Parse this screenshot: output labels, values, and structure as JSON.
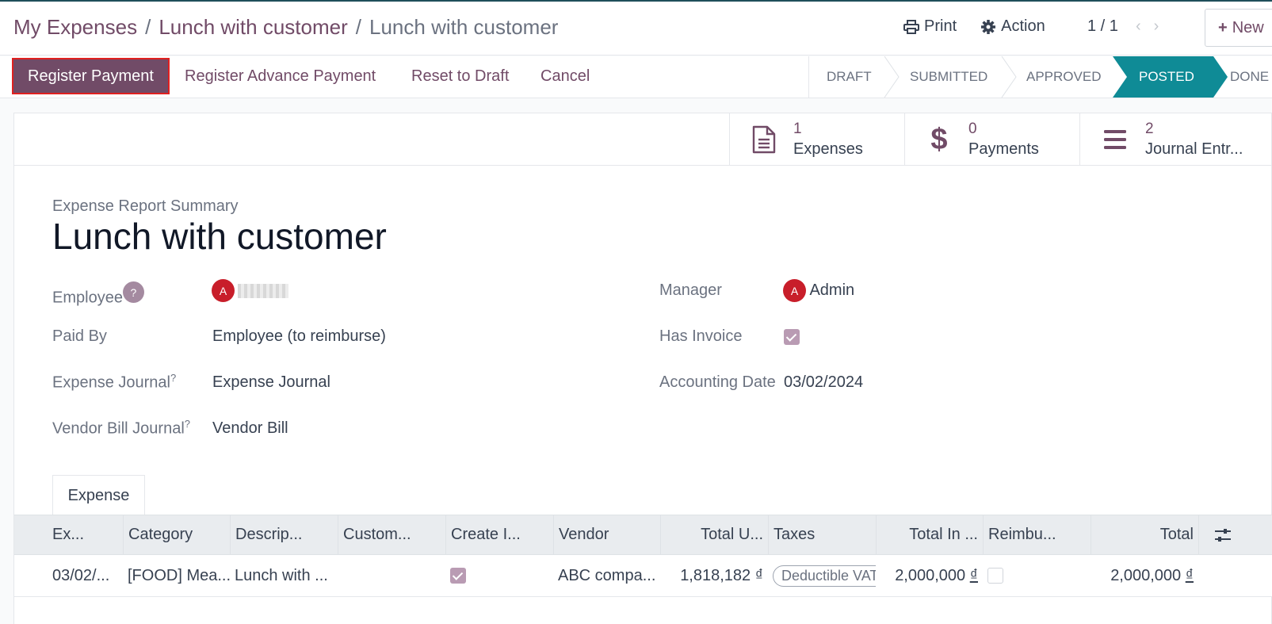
{
  "breadcrumb": {
    "root": "My Expenses",
    "parent": "Lunch with customer",
    "current": "Lunch with customer",
    "sep": "/"
  },
  "controls": {
    "print": "Print",
    "action": "Action",
    "pager": "1 / 1",
    "new": "New"
  },
  "statusbar": {
    "buttons": [
      "Register Payment",
      "Register Advance Payment",
      "Reset to Draft",
      "Cancel"
    ],
    "stages": [
      "DRAFT",
      "SUBMITTED",
      "APPROVED",
      "POSTED",
      "DONE"
    ],
    "active_stage": "POSTED",
    "active_color": "#0f8b96"
  },
  "smart_buttons": [
    {
      "value": "1",
      "label": "Expenses",
      "icon": "document-icon"
    },
    {
      "value": "0",
      "label": "Payments",
      "icon": "dollar-icon"
    },
    {
      "value": "2",
      "label": "Journal Entr...",
      "icon": "bars-icon"
    }
  ],
  "form": {
    "subtitle": "Expense Report Summary",
    "title": "Lunch with customer",
    "employee_label": "Employee",
    "employee_help": "?",
    "employee_initial": "A",
    "paid_by_label": "Paid By",
    "paid_by_value": "Employee (to reimburse)",
    "expense_journal_label": "Expense Journal",
    "expense_journal_value": "Expense Journal",
    "vendor_bill_journal_label": "Vendor Bill Journal",
    "vendor_bill_journal_value": "Vendor Bill",
    "help_mark": "?",
    "manager_label": "Manager",
    "manager_initial": "A",
    "manager_value": "Admin",
    "has_invoice_label": "Has Invoice",
    "has_invoice_checked": true,
    "accounting_date_label": "Accounting Date",
    "accounting_date_value": "03/02/2024"
  },
  "tabs": [
    "Expense"
  ],
  "table": {
    "columns": [
      "Ex...",
      "Category",
      "Descrip...",
      "Custom...",
      "Create I...",
      "Vendor",
      "Total U...",
      "Taxes",
      "Total In ...",
      "Reimbu...",
      "Total"
    ],
    "rows": [
      {
        "date": "03/02/...",
        "category": "[FOOD] Mea...",
        "description": "Lunch with ...",
        "customer": "",
        "create_invoice": true,
        "vendor": "ABC compa...",
        "total_untaxed": "1,818,182",
        "currency": "₫",
        "tax": "Deductible VAT",
        "total_incl": "2,000,000",
        "reimbursed": false,
        "total": "2,000,000"
      }
    ]
  },
  "colors": {
    "brand": "#714b67",
    "active_stage": "#0f8b96",
    "highlight_border": "#e02020",
    "avatar": "#c81e2a"
  }
}
